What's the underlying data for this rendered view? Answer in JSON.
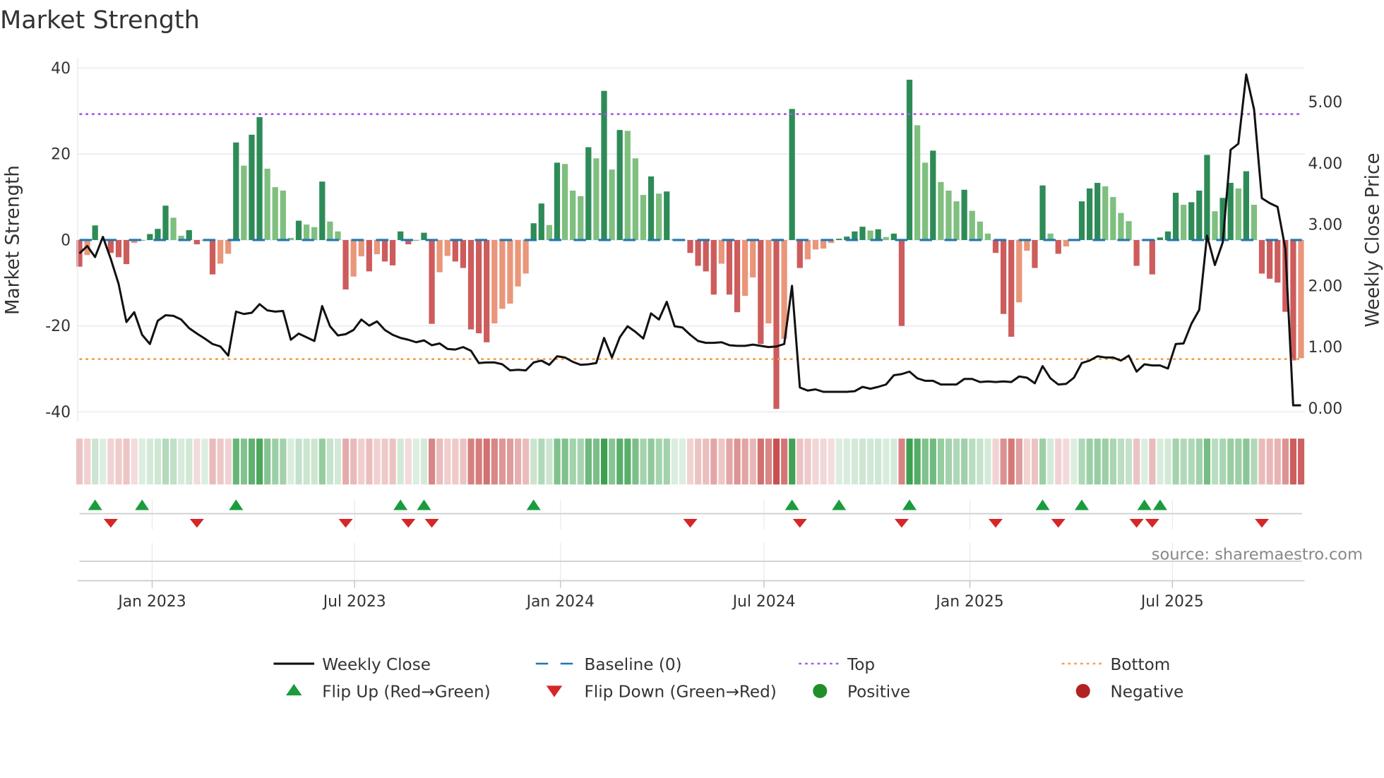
{
  "chart_data": {
    "type": "bar",
    "title": "Market Strength",
    "ylabel": "Market Strength",
    "ylabel_right": "Weekly Close Price",
    "ylim": [
      -42.3,
      42.5
    ],
    "ylim_right": [
      -0.22,
      5.73
    ],
    "yticks": [
      40,
      20,
      0,
      -20,
      -40
    ],
    "yticks_right": [
      "5.00",
      "4.00",
      "3.00",
      "2.00",
      "1.00",
      "0.00"
    ],
    "xlim": [
      "2022-10-28",
      "2025-10-24"
    ],
    "frequency": "weekly",
    "xticks": [
      {
        "date": "2023-01-01",
        "label": "Jan 2023"
      },
      {
        "date": "2023-07-01",
        "label": "Jul 2023"
      },
      {
        "date": "2024-01-01",
        "label": "Jan 2024"
      },
      {
        "date": "2024-07-01",
        "label": "Jul 2024"
      },
      {
        "date": "2025-01-01",
        "label": "Jan 2025"
      },
      {
        "date": "2025-07-01",
        "label": "Jul 2025"
      }
    ],
    "grid": true,
    "top_level": 29.3,
    "bottom_level": -27.7,
    "strength": [
      -6.2,
      -3.5,
      3.4,
      0,
      -3,
      -4,
      -5.6,
      -0.7,
      0,
      1.4,
      2.6,
      8,
      5.2,
      1,
      2.3,
      -1,
      0,
      -8,
      -5.5,
      -3.2,
      22.7,
      17.3,
      24.5,
      28.6,
      16.6,
      12.3,
      11.5,
      0.5,
      4.5,
      3.6,
      3,
      13.6,
      4.3,
      2,
      -11.5,
      -8.5,
      -3.8,
      -7.3,
      -3.3,
      -5,
      -5.9,
      2,
      -1,
      0,
      1.7,
      -19.5,
      -7.5,
      -3.7,
      -5,
      -6.5,
      -20.8,
      -21.7,
      -23.8,
      -19.4,
      -16,
      -14.8,
      -10.8,
      -7.8,
      3.9,
      8.5,
      3.5,
      18,
      17.7,
      11.5,
      10.2,
      21.6,
      19,
      34.7,
      16.4,
      25.6,
      25.4,
      19,
      10.5,
      14.8,
      10.8,
      11.3,
      0.2,
      0,
      -3,
      -6,
      -7.3,
      -12.7,
      -5.5,
      -12.7,
      -16.8,
      -13,
      -8.7,
      -24.2,
      -19.4,
      -39.3,
      -23,
      30.5,
      -6.5,
      -4.5,
      -2.2,
      -2,
      -0.7,
      0.3,
      0.8,
      2,
      3.1,
      2.2,
      2.5,
      0.7,
      1.5,
      -20,
      37.3,
      26.7,
      18,
      20.8,
      13.5,
      11.5,
      9,
      11.7,
      6.8,
      4.3,
      1.5,
      -3,
      -17.2,
      -22.5,
      -14.5,
      -2.5,
      -6.5,
      12.7,
      1.5,
      -3.2,
      -1.5,
      0,
      9,
      12,
      13.3,
      12.5,
      10,
      6.3,
      4.4,
      -6,
      0,
      -8,
      0.6,
      2,
      11,
      8.2,
      8.8,
      11.5,
      19.8,
      6.7,
      9.8,
      13.3,
      12,
      16,
      8.2,
      -7.8,
      -9,
      -9.9,
      -16.7,
      -28,
      -27.5
    ],
    "weekly_close": [
      2.53,
      2.65,
      2.47,
      2.8,
      2.44,
      2.03,
      1.41,
      1.57,
      1.2,
      1.05,
      1.43,
      1.52,
      1.51,
      1.45,
      1.31,
      1.22,
      1.14,
      1.05,
      1.01,
      0.86,
      1.58,
      1.54,
      1.56,
      1.7,
      1.6,
      1.58,
      1.59,
      1.12,
      1.22,
      1.16,
      1.1,
      1.67,
      1.34,
      1.19,
      1.21,
      1.28,
      1.45,
      1.35,
      1.42,
      1.28,
      1.2,
      1.15,
      1.12,
      1.08,
      1.11,
      1.03,
      1.06,
      0.97,
      0.96,
      1.0,
      0.94,
      0.74,
      0.75,
      0.75,
      0.72,
      0.62,
      0.63,
      0.62,
      0.75,
      0.78,
      0.71,
      0.85,
      0.83,
      0.76,
      0.71,
      0.72,
      0.74,
      1.15,
      0.83,
      1.16,
      1.34,
      1.25,
      1.14,
      1.55,
      1.45,
      1.74,
      1.34,
      1.32,
      1.2,
      1.1,
      1.07,
      1.07,
      1.08,
      1.03,
      1.02,
      1.02,
      1.04,
      1.02,
      1.0,
      1.01,
      1.05,
      2.0,
      0.34,
      0.29,
      0.31,
      0.27,
      0.27,
      0.27,
      0.27,
      0.28,
      0.35,
      0.32,
      0.35,
      0.39,
      0.54,
      0.56,
      0.6,
      0.49,
      0.45,
      0.45,
      0.39,
      0.39,
      0.39,
      0.48,
      0.48,
      0.43,
      0.44,
      0.43,
      0.44,
      0.43,
      0.52,
      0.5,
      0.41,
      0.69,
      0.49,
      0.39,
      0.4,
      0.5,
      0.74,
      0.78,
      0.85,
      0.83,
      0.83,
      0.78,
      0.86,
      0.6,
      0.72,
      0.7,
      0.7,
      0.65,
      1.05,
      1.06,
      1.38,
      1.61,
      2.82,
      2.34,
      2.71,
      4.22,
      4.32,
      5.45,
      4.88,
      3.43,
      3.35,
      3.29,
      2.6,
      0.05,
      0.05
    ],
    "flip_up_dates": [
      "2022-11-11",
      "2022-12-23",
      "2023-03-17",
      "2023-08-11",
      "2023-09-01",
      "2023-12-08",
      "2024-07-26",
      "2024-09-06",
      "2024-11-08",
      "2025-03-07",
      "2025-04-11",
      "2025-06-06",
      "2025-06-20"
    ],
    "flip_down_dates": [
      "2022-11-25",
      "2023-02-10",
      "2023-06-23",
      "2023-08-18",
      "2023-09-08",
      "2024-04-26",
      "2024-08-02",
      "2024-11-01",
      "2025-01-24",
      "2025-03-21",
      "2025-05-30",
      "2025-06-13",
      "2025-09-19"
    ],
    "legend": {
      "placement": "bottom",
      "items": [
        {
          "label": "Weekly Close",
          "symbol": "line",
          "color": "#111111"
        },
        {
          "label": "Baseline (0)",
          "symbol": "dash",
          "color": "#1f77b4"
        },
        {
          "label": "Top",
          "symbol": "dot",
          "color": "#a45ee5"
        },
        {
          "label": "Bottom",
          "symbol": "dot",
          "color": "#f0a055"
        },
        {
          "label": "Flip Up (Red→Green)",
          "symbol": "triangle-up",
          "color": "#1a9c3e"
        },
        {
          "label": "Flip Down (Green→Red)",
          "symbol": "triangle-down",
          "color": "#d62728"
        },
        {
          "label": "Positive",
          "symbol": "circle",
          "color": "#1f8f2a"
        },
        {
          "label": "Negative",
          "symbol": "circle",
          "color": "#b22222"
        }
      ]
    },
    "colors": {
      "pos_strong": "#2e8b57",
      "pos_weak": "#7fbf7f",
      "neg_strong": "#cd5c5c",
      "neg_weak": "#e9967a"
    },
    "source": "source: sharemaestro.com"
  }
}
